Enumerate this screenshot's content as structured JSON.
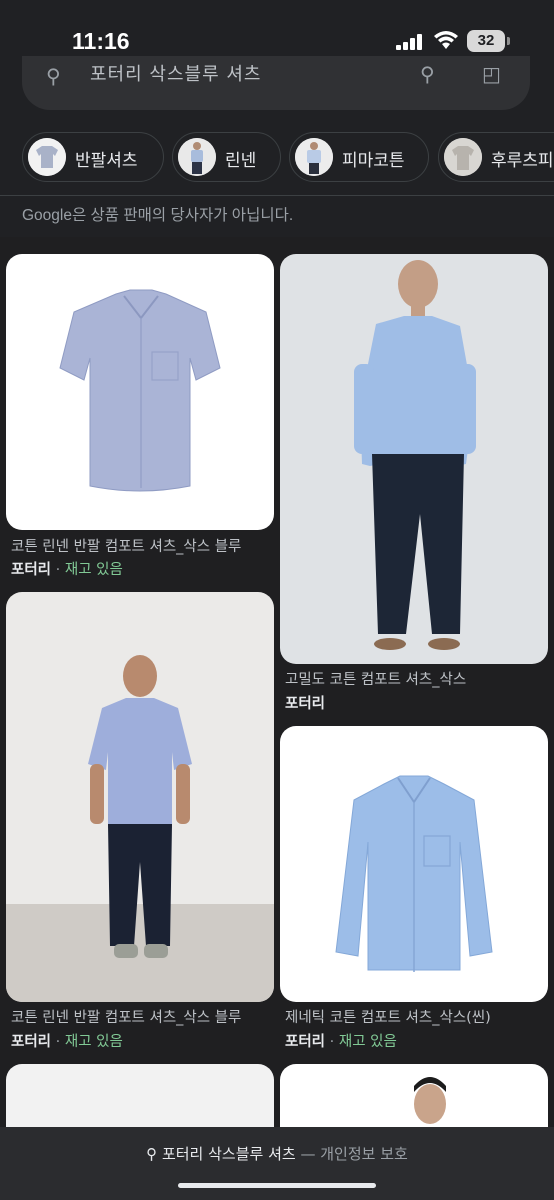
{
  "status": {
    "time": "11:16",
    "battery": "32"
  },
  "search": {
    "query_partial": "포터리 삭스블루 셔츠"
  },
  "chips": [
    {
      "label": "반팔셔츠",
      "icon": "short-sleeve-shirt-thumbnail"
    },
    {
      "label": "린넨",
      "icon": "linen-model-thumbnail"
    },
    {
      "label": "피마코튼",
      "icon": "pima-cotton-model-thumbnail"
    },
    {
      "label": "후루츠피",
      "icon": "fruit-pattern-shirt-thumbnail"
    }
  ],
  "disclaimer": "Google은 상품 판매의 당사자가 아닙니다.",
  "products": [
    {
      "title": "코튼 린넨 반팔 컴포트 셔츠_삭스 블루",
      "seller": "포터리",
      "stock": "재고 있음"
    },
    {
      "title": "고밀도 코튼 컴포트 셔츠_삭스",
      "seller": "포터리",
      "stock": ""
    },
    {
      "title": "코튼 린넨 반팔 컴포트 셔츠_삭스 블루",
      "seller": "포터리",
      "stock": "재고 있음"
    },
    {
      "title": "제네틱 코튼 컴포트 셔츠_삭스(씬)",
      "seller": "포터리",
      "stock": "재고 있음"
    }
  ],
  "footer": {
    "query": "포터리 삭스블루 셔츠",
    "separator": "—",
    "privacy": "개인정보 보호"
  },
  "colors": {
    "background": "#202124",
    "stock_green": "#81c995",
    "shirt_blue": "#9fbde6"
  }
}
